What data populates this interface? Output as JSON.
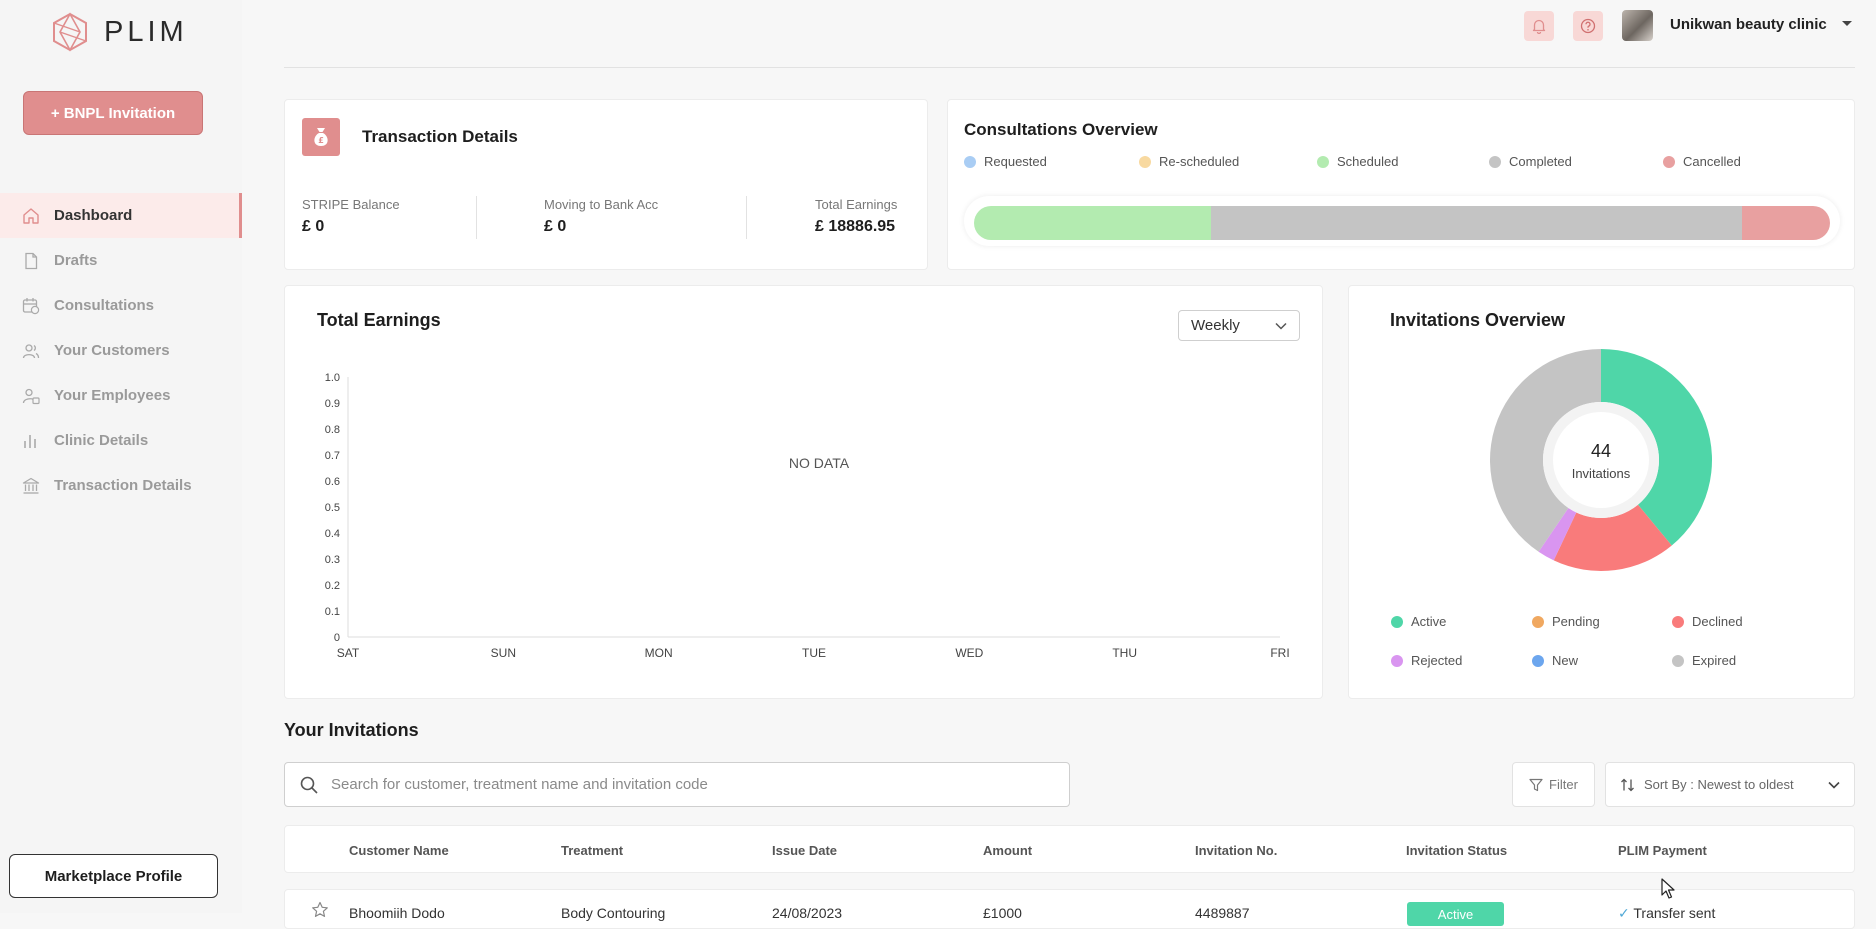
{
  "brand": {
    "name": "PLIM"
  },
  "sidebar": {
    "bnpl_button": "+ BNPL Invitation",
    "items": [
      {
        "label": "Dashboard",
        "icon": "home-icon",
        "active": true
      },
      {
        "label": "Drafts",
        "icon": "document-icon"
      },
      {
        "label": "Consultations",
        "icon": "calendar-clock-icon"
      },
      {
        "label": "Your Customers",
        "icon": "users-icon"
      },
      {
        "label": "Your Employees",
        "icon": "employee-icon"
      },
      {
        "label": "Clinic Details",
        "icon": "bar-chart-icon"
      },
      {
        "label": "Transaction Details",
        "icon": "bank-icon"
      }
    ],
    "marketplace_button": "Marketplace Profile"
  },
  "header": {
    "notification_icon": "bell-icon",
    "help_icon": "question-icon",
    "clinic_name": "Unikwan beauty clinic"
  },
  "transaction_details": {
    "title": "Transaction Details",
    "stripe_label": "STRIPE Balance",
    "stripe_value": "£ 0",
    "moving_label": "Moving to Bank Acc",
    "moving_value": "£ 0",
    "total_label": "Total Earnings",
    "total_value": "£ 18886.95"
  },
  "consultations_overview": {
    "title": "Consultations Overview",
    "legend": [
      {
        "label": "Requested",
        "color": "#a9cdf4"
      },
      {
        "label": "Re-scheduled",
        "color": "#f8d9a0"
      },
      {
        "label": "Scheduled",
        "color": "#b3ebb0"
      },
      {
        "label": "Completed",
        "color": "#c4c4c4"
      },
      {
        "label": "Cancelled",
        "color": "#e8a0a0"
      }
    ],
    "bar_segments": [
      {
        "label": "Scheduled",
        "fraction": 0.277,
        "color": "#b3ebb0"
      },
      {
        "label": "Completed",
        "fraction": 0.62,
        "color": "#c4c4c4"
      },
      {
        "label": "Cancelled",
        "fraction": 0.103,
        "color": "#e8a0a0"
      }
    ]
  },
  "total_earnings": {
    "title": "Total Earnings",
    "period": "Weekly",
    "no_data": "NO DATA"
  },
  "chart_data": {
    "type": "line",
    "title": "Total Earnings",
    "categories": [
      "SAT",
      "SUN",
      "MON",
      "TUE",
      "WED",
      "THU",
      "FRI"
    ],
    "y_ticks": [
      "0",
      "0.1",
      "0.2",
      "0.3",
      "0.4",
      "0.5",
      "0.6",
      "0.7",
      "0.8",
      "0.9",
      "1.0"
    ],
    "ylim": [
      0,
      1.0
    ],
    "series": [],
    "annotation": "NO DATA"
  },
  "invitations_overview": {
    "title": "Invitations Overview",
    "total": "44",
    "total_label": "Invitations",
    "legend": [
      {
        "label": "Active",
        "color": "#4fd6a8"
      },
      {
        "label": "Pending",
        "color": "#f0a860"
      },
      {
        "label": "Declined",
        "color": "#f97b7b"
      },
      {
        "label": "Rejected",
        "color": "#d995f0"
      },
      {
        "label": "New",
        "color": "#6ca6ee"
      },
      {
        "label": "Expired",
        "color": "#c4c4c4"
      }
    ],
    "slices": [
      {
        "label": "Active",
        "fraction": 0.39,
        "color": "#4fd6a8"
      },
      {
        "label": "Declined",
        "fraction": 0.18,
        "color": "#f97b7b"
      },
      {
        "label": "Rejected",
        "fraction": 0.025,
        "color": "#d995f0"
      },
      {
        "label": "Expired",
        "fraction": 0.405,
        "color": "#c4c4c4"
      }
    ]
  },
  "invitations": {
    "title": "Your Invitations",
    "search_placeholder": "Search for customer, treatment name and invitation code",
    "filter_label": "Filter",
    "sort_label": "Sort By : Newest to oldest",
    "columns": [
      "Customer Name",
      "Treatment",
      "Issue Date",
      "Amount",
      "Invitation No.",
      "Invitation Status",
      "PLIM Payment"
    ],
    "rows": [
      {
        "customer": "Bhoomiih Dodo",
        "treatment": "Body Contouring",
        "date": "24/08/2023",
        "amount": "£1000",
        "number": "4489887",
        "status": "Active",
        "payment": "Transfer sent"
      }
    ]
  }
}
